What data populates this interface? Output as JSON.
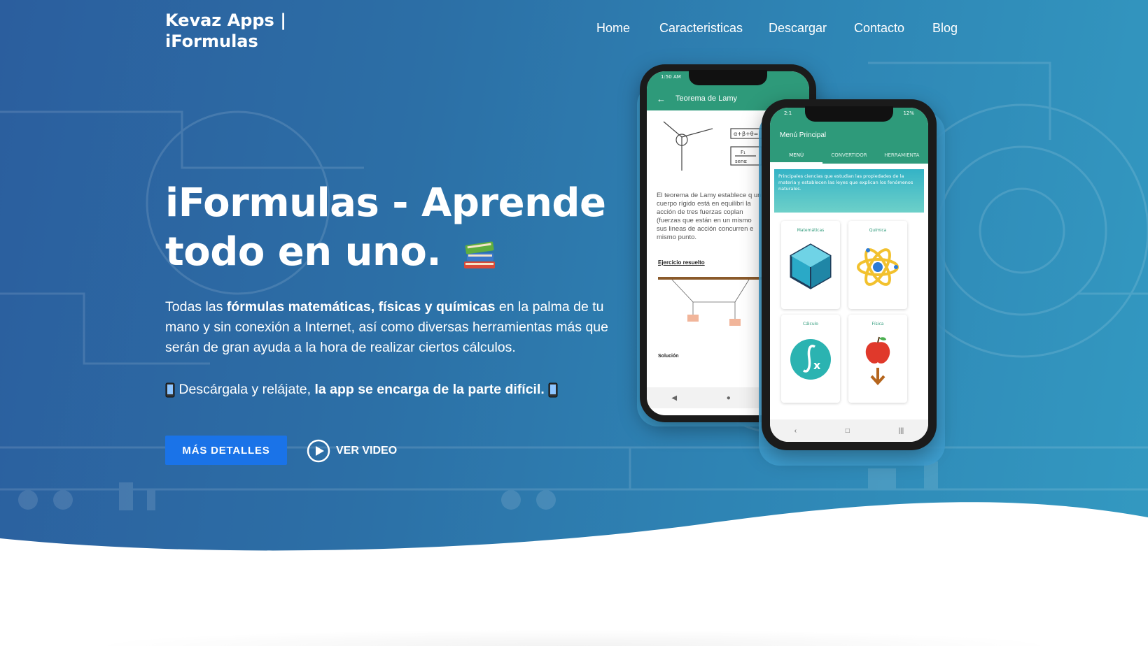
{
  "brand": {
    "line1": "Kevaz Apps |",
    "line2": "iFormulas"
  },
  "nav": {
    "items": [
      "Home",
      "Caracteristicas",
      "Descargar",
      "Contacto",
      "Blog"
    ]
  },
  "hero": {
    "headline_line1": "iFormulas - Aprende",
    "headline_line2": "todo en uno.",
    "desc_part1": "Todas las ",
    "desc_bold": "fórmulas matemáticas, físicas y químicas",
    "desc_part2": " en la palma de tu mano y sin conexión a Internet, así como diversas herramientas más que serán de gran ayuda a la hora de realizar ciertos cálculos.",
    "tagline_part1": "Descárgala y relájate, ",
    "tagline_bold": "la app se encarga de la parte difícil.",
    "more_button": "MÁS DETALLES",
    "video_button": "VER VIDEO"
  },
  "phone_back": {
    "status_time": "1:50 AM",
    "title": "Teorema de Lamy",
    "formula_sum": "α+β+θ=",
    "formula_frac_num": "F₁",
    "formula_frac_den": "senα",
    "paragraph": "El teorema de Lamy establece q un cuerpo rígido está en equilibri la acción de tres fuerzas coplan (fuerzas que están en un mismo sus lineas de acción concurren e mismo punto.",
    "exercise_title": "Ejercicio resuelto",
    "solution_title": "Solución"
  },
  "phone_front": {
    "status_left": "2:1",
    "status_right": "12%",
    "title": "Menú Principal",
    "tabs": [
      "MENÚ",
      "CONVERTIDOR",
      "HERRAMIENTA"
    ],
    "banner": "Principales ciencias que estudian las propiedades de la materia y establecen las leyes que explican los fenómenos naturales.",
    "cards": [
      "Matemáticas",
      "Química",
      "Cálculo",
      "Física"
    ]
  },
  "colors": {
    "accent": "#1a73e8",
    "app_green": "#2e9a7a",
    "hero_start": "#2b5e9e",
    "hero_end": "#3399c1"
  }
}
